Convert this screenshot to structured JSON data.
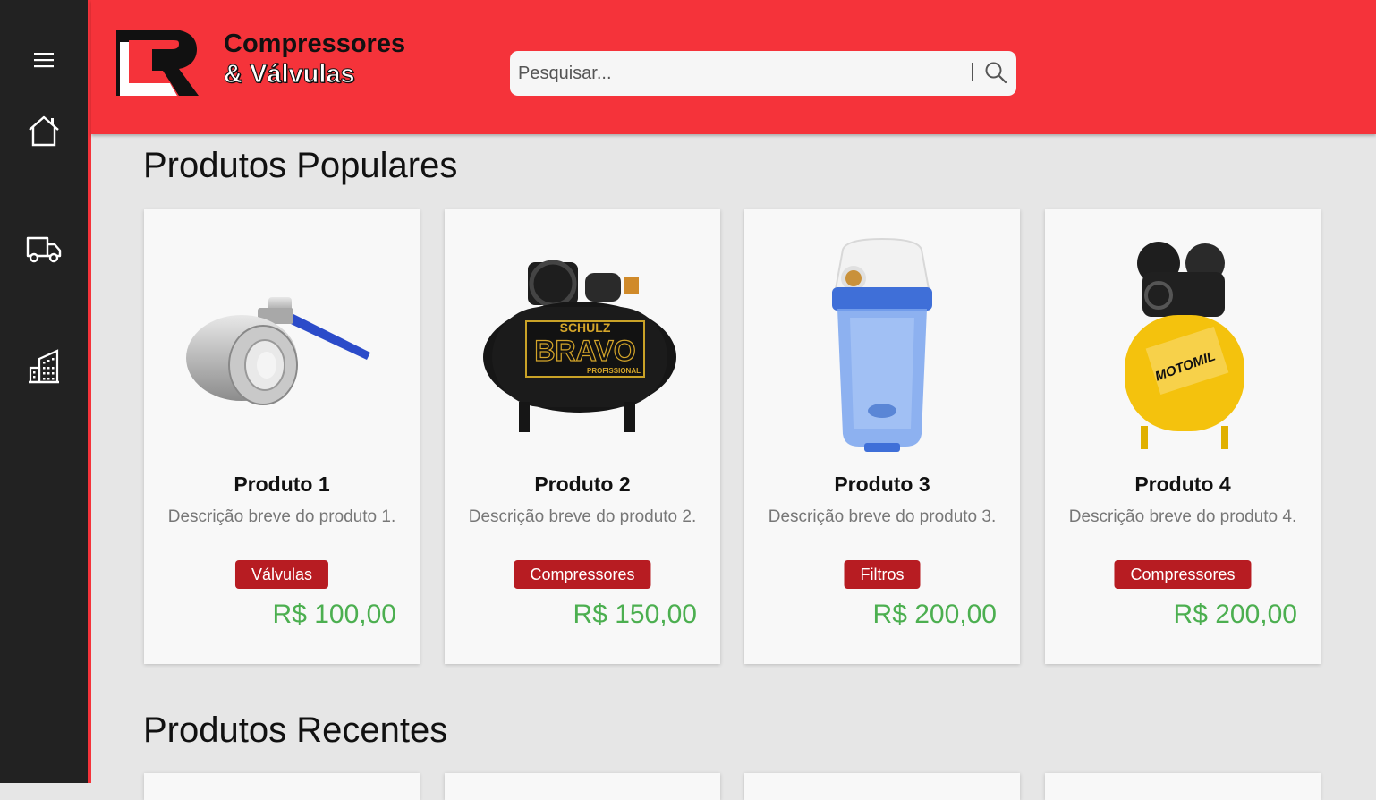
{
  "brand": {
    "line1": "Compressores",
    "line2": "& Válvulas"
  },
  "search": {
    "placeholder": "Pesquisar...",
    "value": ""
  },
  "sidebar": {
    "items": [
      "menu-icon",
      "home-icon",
      "truck-icon",
      "building-icon"
    ]
  },
  "sections": {
    "popular_title": "Produtos Populares",
    "recent_title": "Produtos Recentes"
  },
  "products": [
    {
      "name": "Produto 1",
      "description": "Descrição breve do produto 1.",
      "category": "Válvulas",
      "price": "R$ 100,00",
      "image": "ball-valve"
    },
    {
      "name": "Produto 2",
      "description": "Descrição breve do produto 2.",
      "category": "Compressores",
      "price": "R$ 150,00",
      "image": "black-air-compressor"
    },
    {
      "name": "Produto 3",
      "description": "Descrição breve do produto 3.",
      "category": "Filtros",
      "price": "R$ 200,00",
      "image": "water-filter-housing"
    },
    {
      "name": "Produto 4",
      "description": "Descrição breve do produto 4.",
      "category": "Compressores",
      "price": "R$ 200,00",
      "image": "yellow-air-compressor"
    }
  ],
  "image_text": {
    "compressor2_brand": "SCHULZ",
    "compressor2_model": "BRAVO",
    "compressor2_sub": "PROFISSIONAL",
    "compressor4_brand": "MOTOMIL"
  },
  "colors": {
    "accent": "#f5333a",
    "sidebar": "#222222",
    "badge": "#b71c22",
    "price": "#4caf50",
    "background": "#e6e6e6"
  }
}
